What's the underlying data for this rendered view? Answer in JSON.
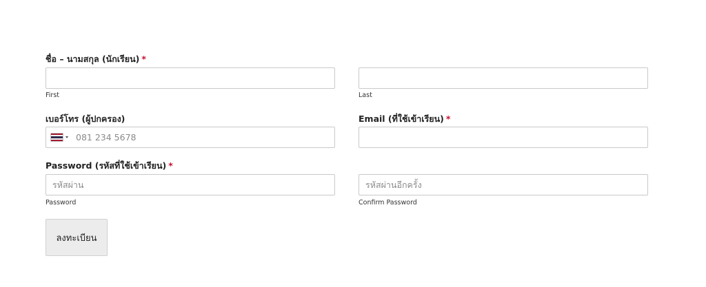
{
  "form": {
    "name_label": "ชื่อ – นามสกุล (นักเรียน)",
    "required_mark": "*",
    "first_sublabel": "First",
    "last_sublabel": "Last",
    "first_value": "",
    "last_value": "",
    "phone_label": "เบอร์โทร (ผู้ปกครอง)",
    "phone_placeholder": "081 234 5678",
    "phone_country_icon": "thailand-flag-icon",
    "email_label": "Email (ที่ใช้เข้าเรียน)",
    "email_value": "",
    "password_label": "Password (รหัสที่ใช้เข้าเรียน)",
    "password_placeholder": "รหัสผ่าน",
    "confirm_placeholder": "รหัสผ่านอีกครั้ง",
    "password_sublabel": "Password",
    "confirm_sublabel": "Confirm Password",
    "submit_label": "ลงทะเบียน"
  },
  "colors": {
    "required": "#c8102e",
    "border": "#c9c9c9",
    "button_bg": "#ececec",
    "flag_red": "#a51931",
    "flag_white": "#f4f5f8",
    "flag_blue": "#2d2a4a"
  }
}
